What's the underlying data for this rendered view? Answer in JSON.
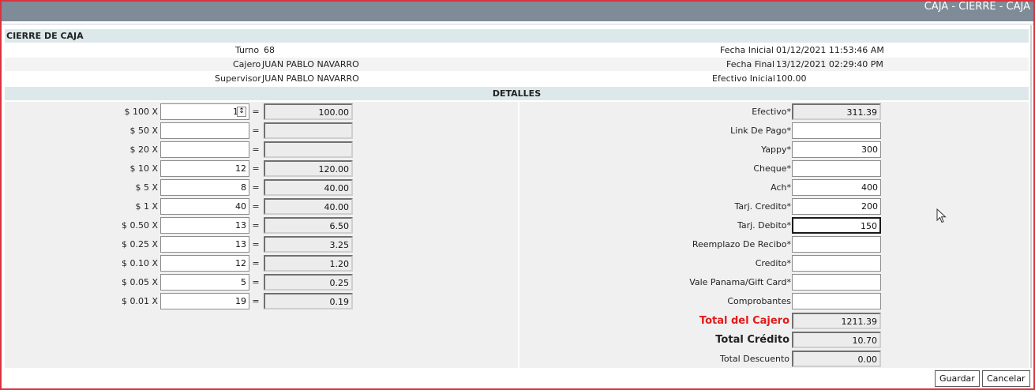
{
  "window": {
    "title": "CAJA - CIERRE - CAJA"
  },
  "sections": {
    "cierre": "CIERRE DE CAJA",
    "detalles": "DETALLES"
  },
  "info": {
    "turno_label": "Turno",
    "turno_value": "68",
    "cajero_label": "Cajero",
    "cajero_value": "JUAN PABLO NAVARRO",
    "supervisor_label": "Supervisor",
    "supervisor_value": "JUAN PABLO NAVARRO",
    "fecha_inicial_label": "Fecha Inicial",
    "fecha_inicial_value": "01/12/2021 11:53:46 AM",
    "fecha_final_label": "Fecha Final",
    "fecha_final_value": "13/12/2021 02:29:40 PM",
    "efectivo_inicial_label": "Efectivo Inicial",
    "efectivo_inicial_value": "100.00"
  },
  "denominations": [
    {
      "label": "$ 100 X",
      "qty": "1",
      "total": "100.00"
    },
    {
      "label": "$ 50 X",
      "qty": "",
      "total": ""
    },
    {
      "label": "$ 20 X",
      "qty": "",
      "total": ""
    },
    {
      "label": "$ 10 X",
      "qty": "12",
      "total": "120.00"
    },
    {
      "label": "$ 5 X",
      "qty": "8",
      "total": "40.00"
    },
    {
      "label": "$ 1 X",
      "qty": "40",
      "total": "40.00"
    },
    {
      "label": "$ 0.50 X",
      "qty": "13",
      "total": "6.50"
    },
    {
      "label": "$ 0.25 X",
      "qty": "13",
      "total": "3.25"
    },
    {
      "label": "$ 0.10 X",
      "qty": "12",
      "total": "1.20"
    },
    {
      "label": "$ 0.05 X",
      "qty": "5",
      "total": "0.25"
    },
    {
      "label": "$ 0.01 X",
      "qty": "19",
      "total": "0.19"
    }
  ],
  "equals": "=",
  "payments": [
    {
      "label": "Efectivo*",
      "value": "311.39"
    },
    {
      "label": "Link De Pago*",
      "value": ""
    },
    {
      "label": "Yappy*",
      "value": "300"
    },
    {
      "label": "Cheque*",
      "value": ""
    },
    {
      "label": "Ach*",
      "value": "400"
    },
    {
      "label": "Tarj. Credito*",
      "value": "200"
    },
    {
      "label": "Tarj. Debito*",
      "value": "150"
    },
    {
      "label": "Reemplazo De Recibo*",
      "value": ""
    },
    {
      "label": "Credito*",
      "value": ""
    },
    {
      "label": "Vale Panama/Gift Card*",
      "value": ""
    },
    {
      "label": "Comprobantes",
      "value": ""
    }
  ],
  "totals": {
    "cajero_label": "Total del Cajero",
    "cajero_value": "1211.39",
    "credito_label": "Total Crédito",
    "credito_value": "10.70",
    "descuento_label": "Total Descuento",
    "descuento_value": "0.00"
  },
  "buttons": {
    "guardar": "Guardar",
    "cancelar": "Cancelar"
  },
  "colors": {
    "accent_red": "#e01b1b",
    "titlebar": "#7f8b96",
    "section": "#dde8ea"
  },
  "icons": {
    "spin": "spinner-icon",
    "cursor": "mouse-pointer-icon"
  }
}
